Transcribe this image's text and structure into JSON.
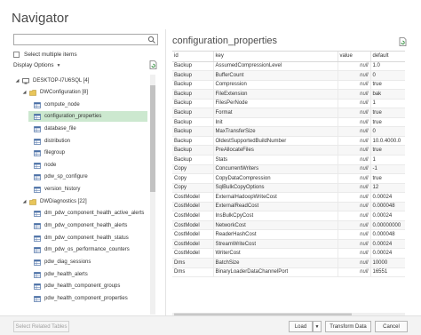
{
  "window": {
    "title": "Navigator"
  },
  "left_pane": {
    "search": {
      "value": "",
      "placeholder": ""
    },
    "select_multiple_label": "Select multiple items",
    "display_options_label": "Display Options",
    "tree": [
      {
        "label": "DESKTOP-I7U6SQL [4]",
        "type": "server",
        "level": 0,
        "expanded": true
      },
      {
        "label": "DWConfiguration [8]",
        "type": "database",
        "level": 1,
        "expanded": true
      },
      {
        "label": "compute_node",
        "type": "table",
        "level": 2
      },
      {
        "label": "configuration_properties",
        "type": "table",
        "level": 2,
        "selected": true
      },
      {
        "label": "database_file",
        "type": "table",
        "level": 2
      },
      {
        "label": "distribution",
        "type": "table",
        "level": 2
      },
      {
        "label": "filegroup",
        "type": "table",
        "level": 2
      },
      {
        "label": "node",
        "type": "table",
        "level": 2
      },
      {
        "label": "pdw_sp_configure",
        "type": "table",
        "level": 2
      },
      {
        "label": "version_history",
        "type": "table",
        "level": 2
      },
      {
        "label": "DWDiagnostics [22]",
        "type": "database",
        "level": 1,
        "expanded": true
      },
      {
        "label": "dm_pdw_component_health_active_alerts",
        "type": "table",
        "level": 2
      },
      {
        "label": "dm_pdw_component_health_alerts",
        "type": "table",
        "level": 2
      },
      {
        "label": "dm_pdw_component_health_status",
        "type": "table",
        "level": 2
      },
      {
        "label": "dm_pdw_os_performance_counters",
        "type": "table",
        "level": 2
      },
      {
        "label": "pdw_diag_sessions",
        "type": "table",
        "level": 2
      },
      {
        "label": "pdw_health_alerts",
        "type": "table",
        "level": 2
      },
      {
        "label": "pdw_health_component_groups",
        "type": "table",
        "level": 2
      },
      {
        "label": "pdw_health_component_properties",
        "type": "table",
        "level": 2
      }
    ]
  },
  "right_pane": {
    "title": "configuration_properties",
    "columns": [
      "id",
      "key",
      "value",
      "default"
    ],
    "rows": [
      [
        "Backup",
        "AssumedCompressionLevel",
        "null",
        "1.0"
      ],
      [
        "Backup",
        "BufferCount",
        "null",
        "0"
      ],
      [
        "Backup",
        "Compression",
        "null",
        "true"
      ],
      [
        "Backup",
        "FileExtension",
        "null",
        "bak"
      ],
      [
        "Backup",
        "FilesPerNode",
        "null",
        "1"
      ],
      [
        "Backup",
        "Format",
        "null",
        "true"
      ],
      [
        "Backup",
        "Init",
        "null",
        "true"
      ],
      [
        "Backup",
        "MaxTransferSize",
        "null",
        "0"
      ],
      [
        "Backup",
        "OldestSupportedBuildNumber",
        "null",
        "10.0.4000.0"
      ],
      [
        "Backup",
        "PreAllocateFiles",
        "null",
        "true"
      ],
      [
        "Backup",
        "Stats",
        "null",
        "1"
      ],
      [
        "Copy",
        "ConcurrentWriters",
        "null",
        "-1"
      ],
      [
        "Copy",
        "CopyDataCompression",
        "null",
        "true"
      ],
      [
        "Copy",
        "SqlBulkCopyOptions",
        "null",
        "12"
      ],
      [
        "CostModel",
        "ExternalHadoopWriteCost",
        "null",
        "0.00024"
      ],
      [
        "CostModel",
        "ExternalReadCost",
        "null",
        "0.000048"
      ],
      [
        "CostModel",
        "InsBulkCpyCost",
        "null",
        "0.00024"
      ],
      [
        "CostModel",
        "NetworkCost",
        "null",
        "0.00000000"
      ],
      [
        "CostModel",
        "ReaderHashCost",
        "null",
        "0.000048"
      ],
      [
        "CostModel",
        "StreamWriteCost",
        "null",
        "0.00024"
      ],
      [
        "CostModel",
        "WriterCost",
        "null",
        "0.00024"
      ],
      [
        "Dms",
        "BatchSize",
        "null",
        "10000"
      ],
      [
        "Dms",
        "BinaryLoaderDataChannelPort",
        "null",
        "16551"
      ]
    ]
  },
  "footer": {
    "select_related_label": "Select Related Tables",
    "load_label": "Load",
    "transform_label": "Transform Data",
    "cancel_label": "Cancel"
  }
}
